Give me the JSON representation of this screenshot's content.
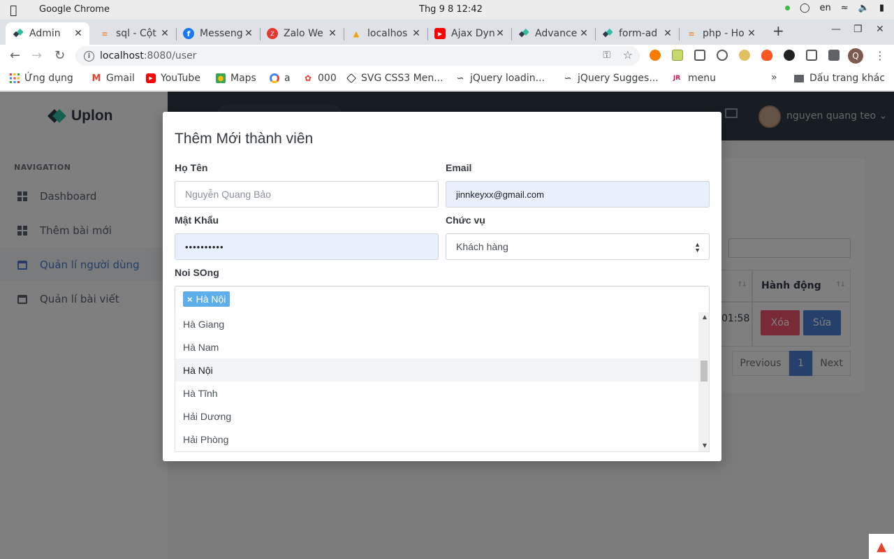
{
  "os": {
    "app_name": "Google Chrome",
    "clock": "Thg 9 8  12:42",
    "lang": "en"
  },
  "tabs": [
    {
      "title": "Admin",
      "active": true,
      "favicon": "uplon-icon",
      "color": "#313a46"
    },
    {
      "title": "sql - Cột",
      "favicon": "stackoverflow-icon",
      "color": "#f48024"
    },
    {
      "title": "Messeng",
      "favicon": "facebook-icon",
      "color": "#1877f2"
    },
    {
      "title": "Zalo We",
      "favicon": "zalo-icon",
      "color": "#e53935"
    },
    {
      "title": "localhos",
      "favicon": "phpmyadmin-icon",
      "color": "#f0a30a"
    },
    {
      "title": "Ajax Dyn",
      "favicon": "youtube-icon",
      "color": "#ff0000"
    },
    {
      "title": "Advance",
      "favicon": "uplon-icon",
      "color": "#313a46"
    },
    {
      "title": "form-ad",
      "favicon": "uplon-icon",
      "color": "#313a46"
    },
    {
      "title": "php - Ho",
      "favicon": "stackoverflow-icon",
      "color": "#f48024"
    }
  ],
  "omnibox": {
    "host": "localhost",
    "path": ":8080/user"
  },
  "profile_initial": "Q",
  "bookmarks": [
    {
      "label": "Ứng dụng",
      "icon": "apps-grid-icon"
    },
    {
      "label": "Gmail",
      "icon": "gmail-icon"
    },
    {
      "label": "YouTube",
      "icon": "youtube-icon"
    },
    {
      "label": "Maps",
      "icon": "maps-icon"
    },
    {
      "label": "a",
      "icon": "chrome-swirl-icon"
    },
    {
      "label": "000",
      "icon": "000webhost-icon"
    },
    {
      "label": "SVG CSS3 Men...",
      "icon": "codepen-icon"
    },
    {
      "label": "jQuery loadin...",
      "icon": "jquery-icon"
    },
    {
      "label": "jQuery Sugges...",
      "icon": "jquery-icon"
    },
    {
      "label": "menu",
      "icon": "jr-icon"
    }
  ],
  "bookmarks_overflow": "»",
  "other_bookmarks": "Dấu trang khác",
  "app": {
    "logo": "Uplon",
    "nav_title": "NAVIGATION",
    "nav": [
      {
        "label": "Dashboard",
        "icon": "grid-icon"
      },
      {
        "label": "Thêm bài mới",
        "icon": "grid-icon"
      },
      {
        "label": "Quản lí người dùng",
        "icon": "calendar-icon",
        "active": true
      },
      {
        "label": "Quản lí bài viết",
        "icon": "calendar-icon"
      }
    ],
    "user_name": "nguyen quang teo",
    "table_header_action": "Hành động",
    "cell_time_fragment": "01:58",
    "delete_label": "Xóa",
    "edit_label": "Sửa",
    "pager": {
      "prev": "Previous",
      "page": "1",
      "next": "Next"
    }
  },
  "modal": {
    "title": "Thêm Mới thành viên",
    "name_label": "Họ Tên",
    "name_placeholder": "Nguyễn Quang Bảo",
    "email_label": "Email",
    "email_value": "jinnkeyxx@gmail.com",
    "password_label": "Mật Khẩu",
    "password_value": "••••••••••",
    "role_label": "Chức vụ",
    "role_value": "Khách hàng",
    "place_label": "Noi SOng",
    "selected_tag": "Hà Nội",
    "options": [
      {
        "label": "Hà Giang"
      },
      {
        "label": "Hà Nam"
      },
      {
        "label": "Hà Nội",
        "highlighted": true
      },
      {
        "label": "Hà Tĩnh"
      },
      {
        "label": "Hải Dương"
      },
      {
        "label": "Hải Phòng"
      }
    ]
  }
}
